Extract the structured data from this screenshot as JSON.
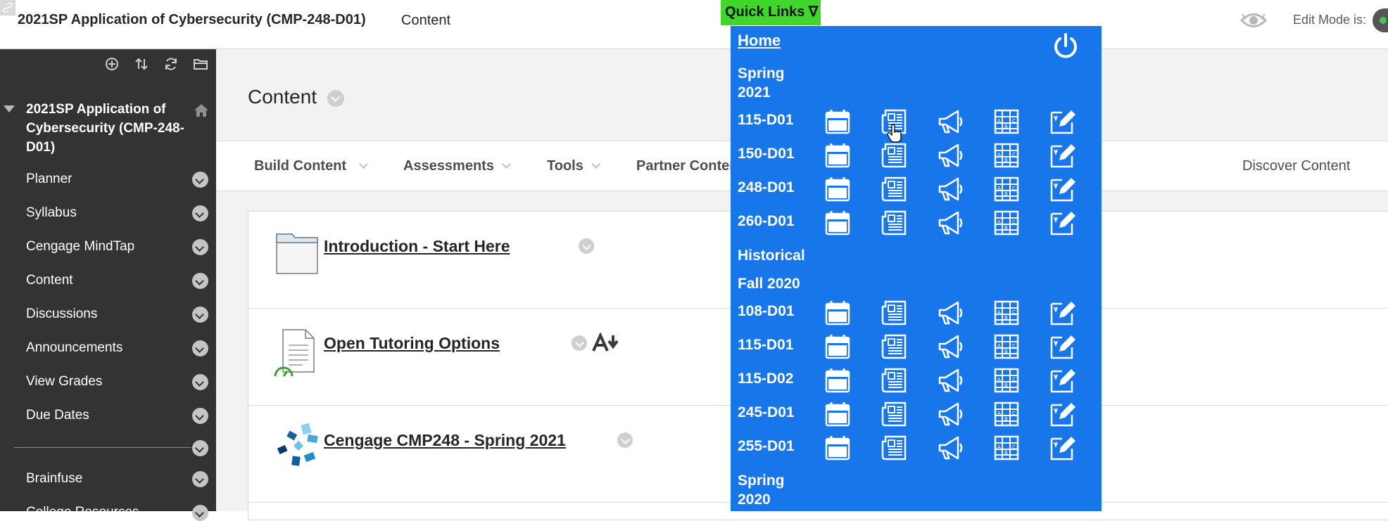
{
  "header": {
    "course_title": "2021SP Application of Cybersecurity (CMP-248-D01)",
    "breadcrumb": "Content",
    "edit_mode_label": "Edit Mode is:"
  },
  "sidebar": {
    "course_name": "2021SP Application of Cybersecurity (CMP-248-D01)",
    "items": [
      {
        "label": "Planner"
      },
      {
        "label": "Syllabus"
      },
      {
        "label": "Cengage MindTap"
      },
      {
        "label": "Content"
      },
      {
        "label": "Discussions"
      },
      {
        "label": "Announcements"
      },
      {
        "label": "View Grades"
      },
      {
        "label": "Due Dates"
      },
      {
        "label": "Brainfuse"
      },
      {
        "label": "College Resources"
      }
    ]
  },
  "main": {
    "heading": "Content",
    "menu": [
      "Build Content",
      "Assessments",
      "Tools",
      "Partner Content"
    ],
    "discover": "Discover Content",
    "items": [
      {
        "title": "Introduction - Start Here"
      },
      {
        "title": "Open Tutoring Options"
      },
      {
        "title": "Cengage CMP248 - Spring 2021"
      }
    ]
  },
  "quick_links": {
    "button_label": "Quick Links ∇",
    "home_label": "Home",
    "sections": [
      {
        "heading": "Spring 2021",
        "courses": [
          "115-D01",
          "150-D01",
          "248-D01",
          "260-D01"
        ]
      },
      {
        "heading": "Historical",
        "courses": []
      },
      {
        "heading": "Fall 2020",
        "courses": [
          "108-D01",
          "115-D01",
          "115-D02",
          "245-D01",
          "255-D01"
        ]
      },
      {
        "heading": "Spring 2020",
        "courses": []
      }
    ],
    "row_icons": [
      "calendar-icon",
      "newspaper-icon",
      "megaphone-icon",
      "gradebook-icon",
      "edit-icon"
    ]
  },
  "colors": {
    "quick_links_panel": "#1777ea",
    "quick_links_button": "#3fd82a",
    "sidebar": "#333333"
  }
}
